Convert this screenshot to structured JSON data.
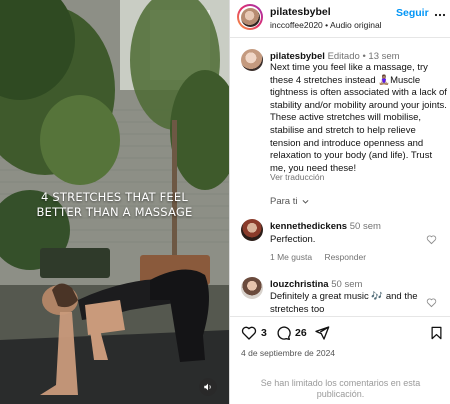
{
  "media": {
    "overlay_line1": "4 STRETCHES THAT FEEL",
    "overlay_line2": "BETTER THAN A MASSAGE",
    "sound_icon": "speaker-icon"
  },
  "header": {
    "username": "pilatesbybel",
    "collaborator": "inccoffee2020",
    "separator": "•",
    "audio": "Audio original",
    "follow_label": "Seguir",
    "more_icon": "more-horizontal-icon"
  },
  "caption": {
    "username": "pilatesbybel",
    "edited": "Editado",
    "dot": "•",
    "time": "13 sem",
    "text": "Next time you feel like a massage, try these 4 stretches instead 🧘🏽‍♀️Muscle tightness is often associated with a lack of stability and/or mobility around your joints. These active stretches will mobilise, stabilise and stretch to help relieve tension and introduce openness and relaxation to your body (and life). Trust me, you need these!",
    "translate": "Ver traducción"
  },
  "para_ti": {
    "label": "Para ti",
    "chevron": "chevron-down-icon"
  },
  "comments": [
    {
      "username": "kennethedickens",
      "time": "50 sem",
      "text": "Perfection.",
      "likes": "1 Me gusta",
      "reply": "Responder"
    },
    {
      "username": "louzchristina",
      "time": "50 sem",
      "text": "Definitely a great music 🎶 and the stretches too"
    }
  ],
  "actions": {
    "likes": "3",
    "comments": "26",
    "date": "4 de septiembre de 2024"
  },
  "footer": {
    "text": "Se han limitado los comentarios en esta publicación."
  },
  "colors": {
    "accent": "#0095f6",
    "muted": "#737373"
  }
}
